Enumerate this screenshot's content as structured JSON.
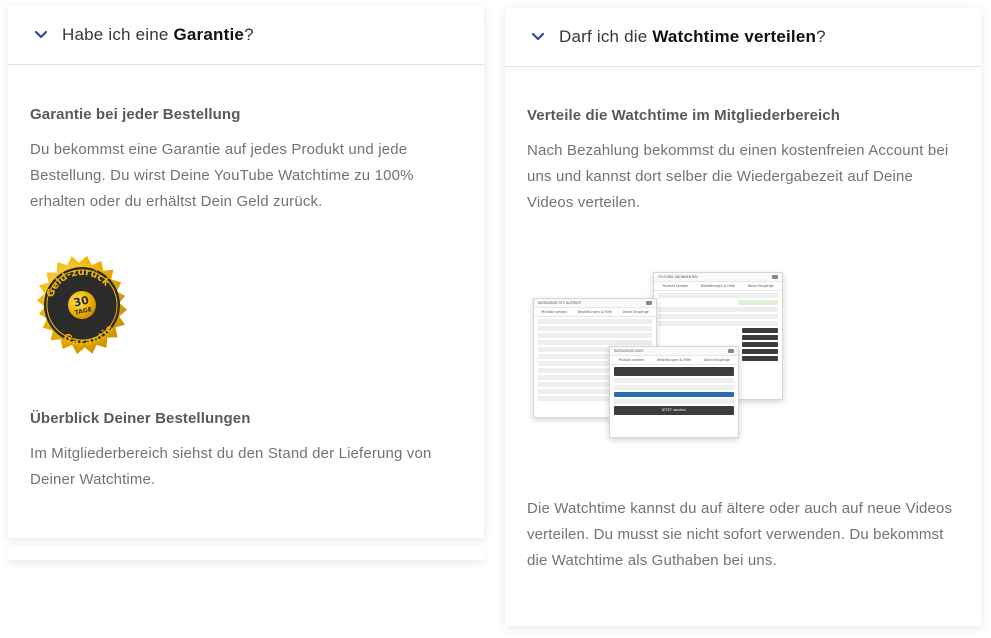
{
  "left": {
    "header": {
      "prefix": "Habe ich eine ",
      "bold": "Garantie",
      "suffix": "?"
    },
    "section1": {
      "title": "Garantie bei jeder Bestellung",
      "text": "Du bekommst eine Garantie auf jedes Produkt und jede Bestellung. Du wirst Deine YouTube Watchtime zu 100% erhalten oder du erhältst Dein Geld zurück."
    },
    "badge": {
      "line1": "Geld-zurück",
      "number": "30",
      "days": "TAGE",
      "line2": "Garantie"
    },
    "section2": {
      "title": "Überblick Deiner Bestellungen",
      "text": "Im Mitgliederbereich siehst du den Stand der Lieferung von Deiner Watchtime."
    }
  },
  "right": {
    "header": {
      "prefix": "Darf ich die ",
      "bold": "Watchtime verteilen",
      "suffix": "?"
    },
    "section1": {
      "title": "Verteile die Watchtime im Mitgliederbereich",
      "text": "Nach Bezahlung bekommst du einen kostenfreien Account bei uns und kannst dort selber die Wiedergabezeit auf Deine Videos verteilen."
    },
    "screens": {
      "a_title": "INSTAGRAM GTV AUFRUFE",
      "b_title": "YOUTUBE ABONNENTEN",
      "c_title": "INSTAGRAM LIKES",
      "tab1": "Produkt senden",
      "tab2": "Bestellungen & Hilfe",
      "tab3": "Deine Eingänge",
      "c_button": "JETZT senden"
    },
    "section2": {
      "text": "Die Watchtime kannst du auf ältere oder auch auf neue Videos verteilen. Du musst sie nicht sofort verwenden. Du bekommst die Watchtime als Guthaben bei uns."
    }
  },
  "colors": {
    "chevron": "#2d4c9c",
    "badge_gold": "#f2b705",
    "badge_dark": "#2b2b2b"
  },
  "icons": {
    "chevron": "chevron-down-icon"
  }
}
